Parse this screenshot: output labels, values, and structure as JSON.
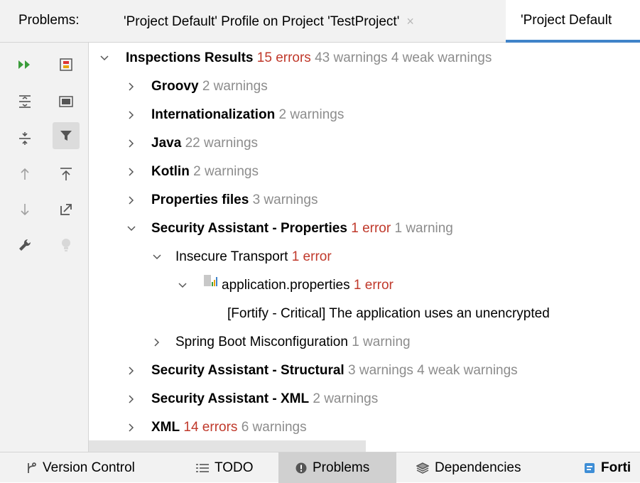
{
  "header": {
    "title": "Problems:",
    "tabs": [
      {
        "label": "'Project Default' Profile on Project 'TestProject'",
        "close": "×"
      },
      {
        "label": "'Project Default"
      }
    ]
  },
  "toolbar": {
    "icons": [
      "run-icon",
      "stop-icon",
      "expand-all-icon",
      "group-icon",
      "collapse-all-icon",
      "filter-icon",
      "previous-icon",
      "export-icon",
      "next-icon",
      "open-external-icon",
      "wrench-icon",
      "lightbulb-icon"
    ]
  },
  "tree": {
    "root": {
      "label": "Inspections Results",
      "errors": "15 errors",
      "warnings": "43 warnings 4 weak warnings"
    },
    "groups": [
      {
        "label": "Groovy",
        "count": "2 warnings"
      },
      {
        "label": "Internationalization",
        "count": "2 warnings"
      },
      {
        "label": "Java",
        "count": "22 warnings"
      },
      {
        "label": "Kotlin",
        "count": "2 warnings"
      },
      {
        "label": "Properties files",
        "count": "3 warnings"
      }
    ],
    "security_properties": {
      "label": "Security Assistant - Properties",
      "errors": "1 error",
      "warnings": "1 warning"
    },
    "insecure_transport": {
      "label": "Insecure Transport",
      "errors": "1 error"
    },
    "file": {
      "label": "application.properties",
      "errors": "1 error"
    },
    "issue": {
      "label": "[Fortify - Critical] The application uses an unencrypted"
    },
    "spring_boot": {
      "label": "Spring Boot Misconfiguration",
      "warnings": "1 warning"
    },
    "security_structural": {
      "label": "Security Assistant - Structural",
      "warnings": "3 warnings 4 weak warnings"
    },
    "security_xml": {
      "label": "Security Assistant - XML",
      "warnings": "2 warnings"
    },
    "xml": {
      "label": "XML",
      "errors": "14 errors",
      "warnings": "6 warnings"
    }
  },
  "bottom_bar": {
    "items": [
      {
        "label": "Version Control",
        "icon": "version-control-icon"
      },
      {
        "label": "TODO",
        "icon": "list-icon"
      },
      {
        "label": "Problems",
        "icon": "problems-icon"
      },
      {
        "label": "Dependencies",
        "icon": "dependencies-icon"
      },
      {
        "label": "Forti",
        "icon": "fortify-icon"
      }
    ]
  },
  "colors": {
    "error": "#c0392b",
    "warning": "#8c8c8c",
    "accent": "#4083c9"
  }
}
